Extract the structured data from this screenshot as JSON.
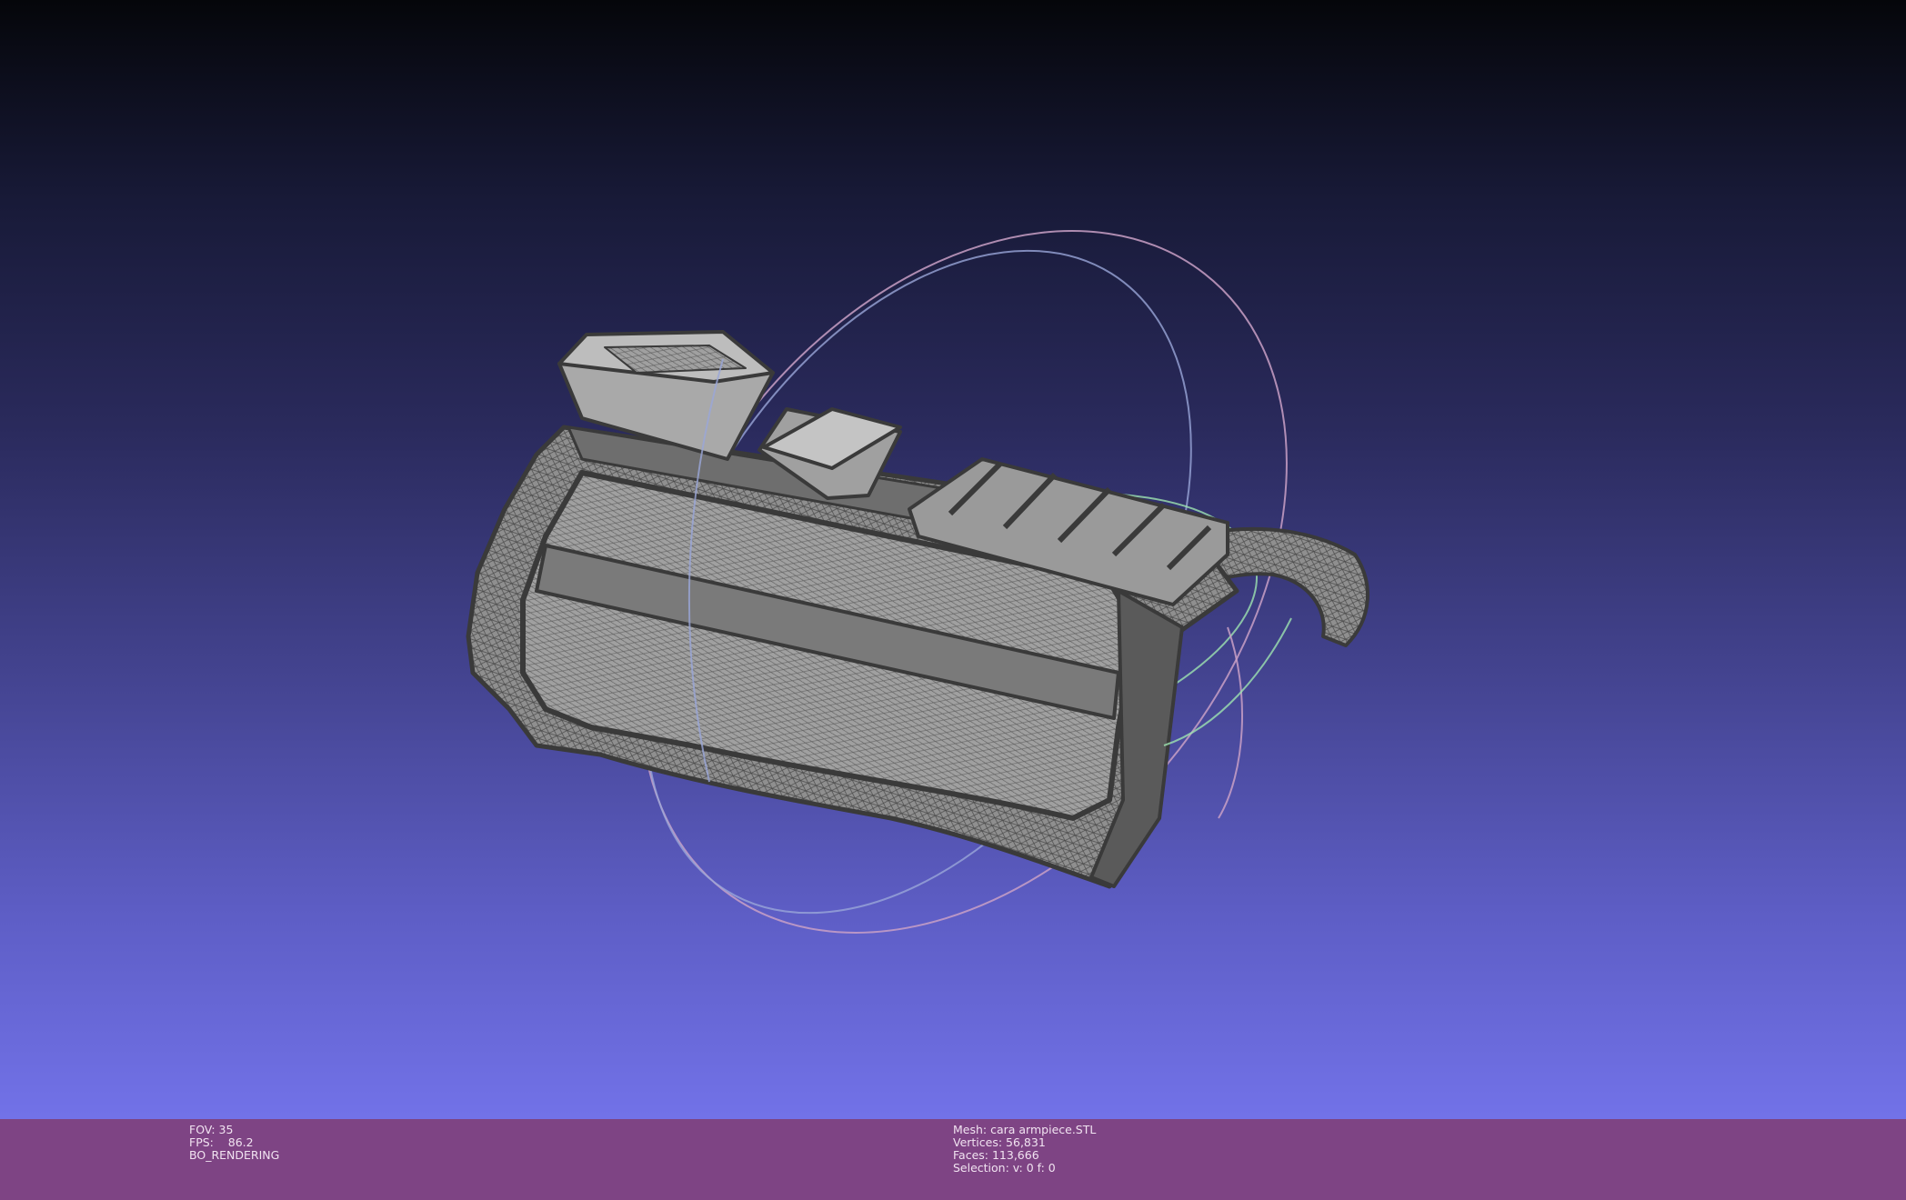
{
  "viewport": {
    "scene_description": "wireframe mesh of armpiece with trackball rings",
    "background_top": "#05060a",
    "background_bottom": "#7272e8",
    "mesh_fill": "#8e8e8e",
    "mesh_edge": "#3e3e3e",
    "trackball_colors": [
      "#cfa6c9",
      "#9fb0e6",
      "#9ee6b2"
    ]
  },
  "status_bar": {
    "background": "#7e4484",
    "render_info": {
      "fov": "FOV: 35",
      "fps": "FPS:    86.2",
      "mode": "BO_RENDERING"
    },
    "mesh_info": {
      "mesh": "Mesh: cara armpiece.STL",
      "vertices": "Vertices: 56,831",
      "faces": "Faces: 113,666",
      "selection": "Selection: v: 0 f: 0"
    }
  }
}
